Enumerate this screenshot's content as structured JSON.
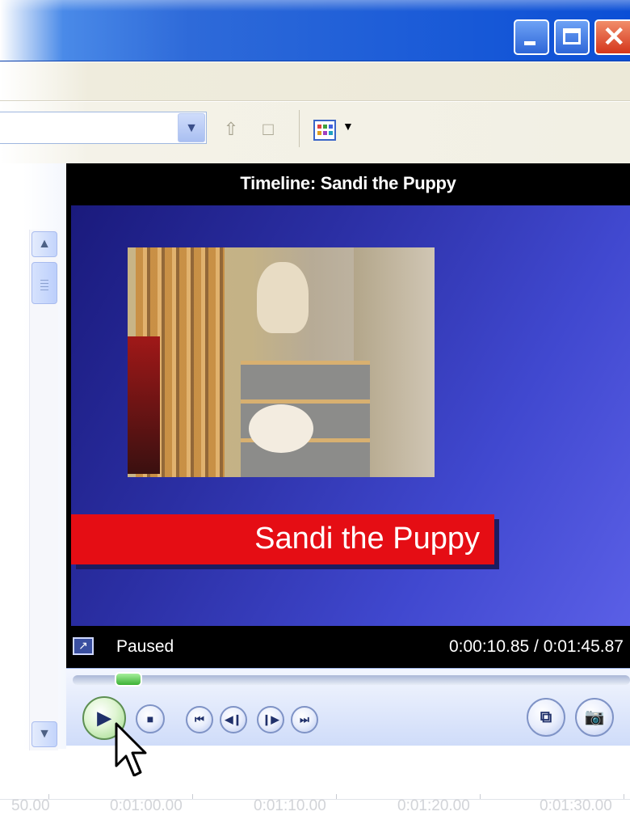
{
  "window": {
    "minimize_icon": "minimize-icon",
    "maximize_icon": "maximize-icon",
    "close_icon": "close-icon",
    "close_glyph": "✕"
  },
  "toolbar": {
    "combo_value": "",
    "icons": [
      "up-folder-icon",
      "new-folder-icon",
      "views-icon"
    ]
  },
  "monitor": {
    "title": "Timeline: Sandi the Puppy",
    "caption": "Sandi the Puppy",
    "status": "Paused",
    "time": "0:00:10.85 / 0:01:45.87",
    "seek_progress": 0.1
  },
  "controls": {
    "play_glyph": "▶",
    "stop_glyph": "■",
    "prev_glyph": "⏮",
    "back_frame_glyph": "◀❙",
    "fwd_frame_glyph": "❙▶",
    "next_glyph": "⏭",
    "split_glyph": "⧉",
    "snapshot_glyph": "📷"
  },
  "ruler": {
    "labels": [
      "50.00",
      "0:01:00.00",
      "0:01:10.00",
      "0:01:20.00",
      "0:01:30.00"
    ]
  },
  "colors": {
    "banner": "#e50d14",
    "preview_gradient_start": "#1a1a7c",
    "preview_gradient_end": "#5a5fe6",
    "seek_thumb": "#3ab034"
  }
}
